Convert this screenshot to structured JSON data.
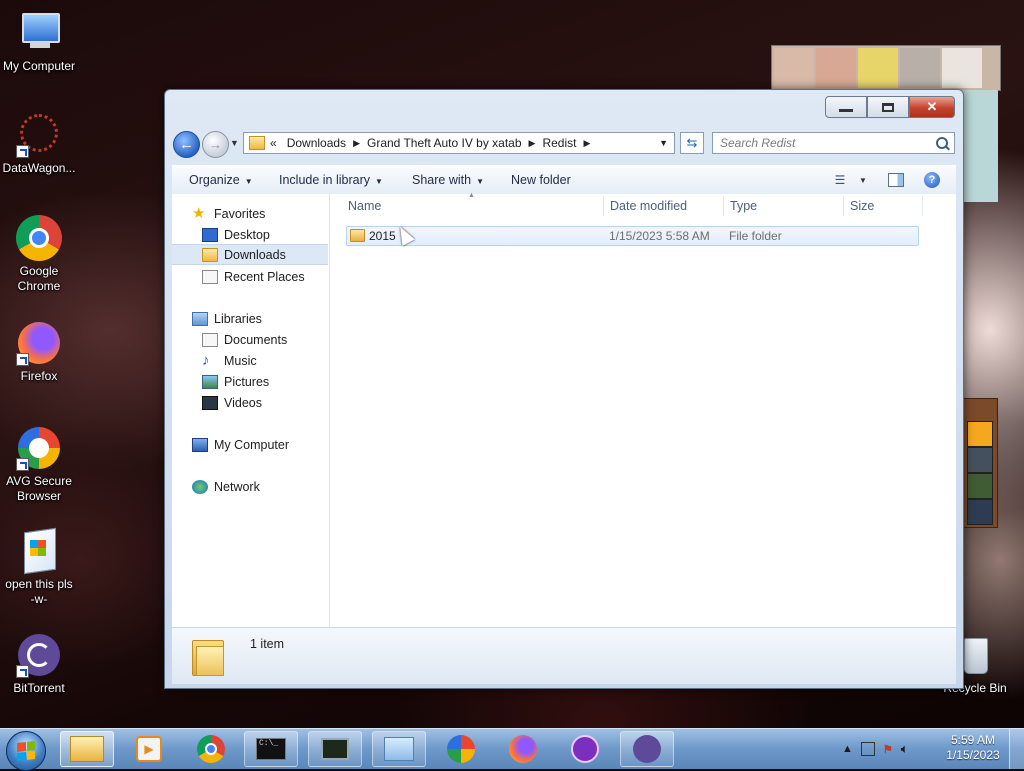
{
  "desktop": {
    "icons": [
      {
        "label": "My Computer",
        "icon": "my-computer-icon"
      },
      {
        "label": "DataWagon...",
        "icon": "datawagon-icon"
      },
      {
        "label": "Google Chrome",
        "icon": "chrome-icon"
      },
      {
        "label": "Firefox",
        "icon": "firefox-icon"
      },
      {
        "label": "AVG Secure Browser",
        "icon": "avg-browser-icon"
      },
      {
        "label": "open this pls -w-",
        "icon": "installer-icon"
      },
      {
        "label": "BitTorrent",
        "icon": "bittorrent-icon"
      },
      {
        "label": "Recycle Bin",
        "icon": "recycle-bin-icon"
      }
    ]
  },
  "window": {
    "controls": {
      "minimize": "minimize",
      "maximize": "maximize",
      "close": "✕"
    },
    "address": {
      "overflow": "«",
      "crumbs": [
        "Downloads",
        "Grand Theft Auto IV by xatab",
        "Redist"
      ]
    },
    "search_placeholder": "Search Redist",
    "toolbar": {
      "organize": "Organize",
      "include_in_library": "Include in library",
      "share_with": "Share with",
      "new_folder": "New folder"
    },
    "nav": {
      "favorites": "Favorites",
      "desktop": "Desktop",
      "downloads": "Downloads",
      "recent_places": "Recent Places",
      "libraries": "Libraries",
      "documents": "Documents",
      "music": "Music",
      "pictures": "Pictures",
      "videos": "Videos",
      "my_computer": "My Computer",
      "network": "Network"
    },
    "columns": {
      "name": "Name",
      "date_modified": "Date modified",
      "type": "Type",
      "size": "Size"
    },
    "files": [
      {
        "name": "2015",
        "date_modified": "1/15/2023 5:58 AM",
        "type": "File folder",
        "size": ""
      }
    ],
    "status": {
      "item_count": "1 item"
    }
  },
  "taskbar": {
    "apps": [
      "windows-explorer",
      "media-player",
      "google-chrome",
      "command-prompt",
      "task-manager",
      "control-panel",
      "avg-secure-browser",
      "firefox",
      "game-launcher",
      "bittorrent"
    ],
    "clock": {
      "time": "5:59 AM",
      "date": "1/15/2023"
    }
  }
}
